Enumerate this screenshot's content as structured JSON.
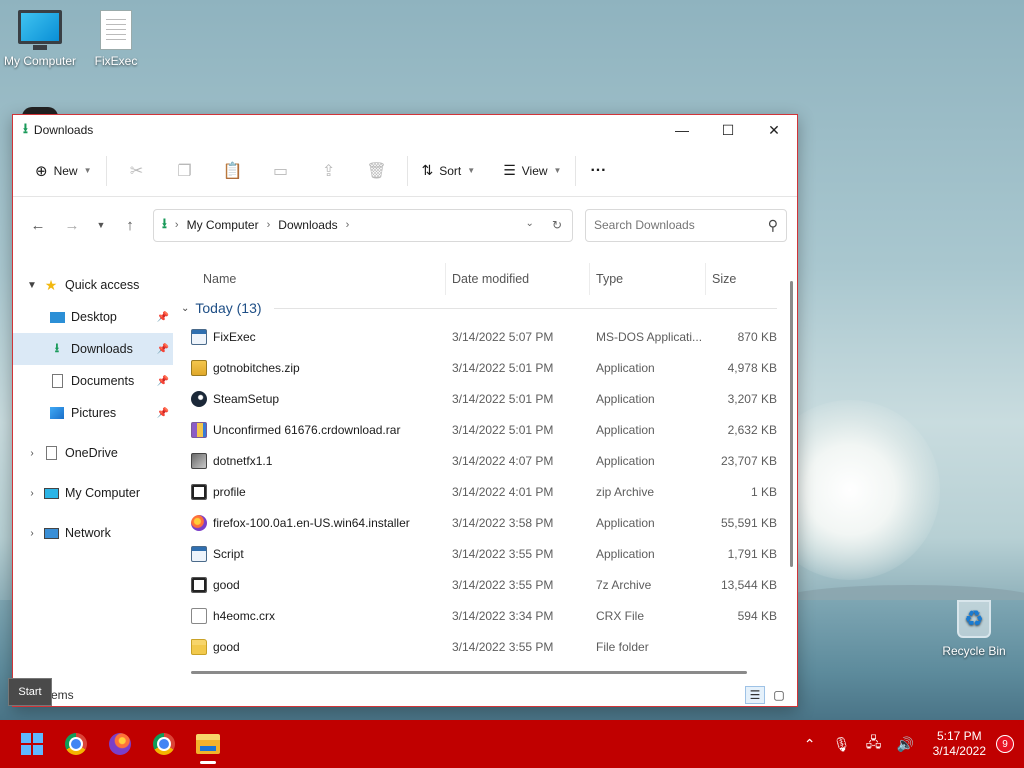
{
  "desktop": {
    "icons": [
      {
        "label": "My Computer"
      },
      {
        "label": "FixExec"
      },
      {
        "label": "Recycle Bin"
      }
    ]
  },
  "window": {
    "title": "Downloads",
    "controls": {
      "minimize": "—",
      "maximize": "☐",
      "close": "✕"
    },
    "toolbar": {
      "new_label": "New",
      "sort_label": "Sort",
      "view_label": "View",
      "more_label": "···"
    },
    "address": {
      "crumb1": "My Computer",
      "crumb2": "Downloads"
    },
    "search": {
      "placeholder": "Search Downloads"
    },
    "sidebar": {
      "quick_access": "Quick access",
      "items": [
        "Desktop",
        "Downloads",
        "Documents",
        "Pictures"
      ],
      "onedrive": "OneDrive",
      "my_computer": "My Computer",
      "network": "Network"
    },
    "columns": {
      "name": "Name",
      "date": "Date modified",
      "type": "Type",
      "size": "Size"
    },
    "group": "Today (13)",
    "files": [
      {
        "name": "FixExec",
        "date": "3/14/2022 5:07 PM",
        "type": "MS-DOS Applicati...",
        "size": "870 KB",
        "icon": "fi-app"
      },
      {
        "name": "gotnobitches.zip",
        "date": "3/14/2022 5:01 PM",
        "type": "Application",
        "size": "4,978 KB",
        "icon": "fi-zip"
      },
      {
        "name": "SteamSetup",
        "date": "3/14/2022 5:01 PM",
        "type": "Application",
        "size": "3,207 KB",
        "icon": "fi-steam"
      },
      {
        "name": "Unconfirmed 61676.crdownload.rar",
        "date": "3/14/2022 5:01 PM",
        "type": "Application",
        "size": "2,632 KB",
        "icon": "fi-rar"
      },
      {
        "name": "dotnetfx1.1",
        "date": "3/14/2022 4:07 PM",
        "type": "Application",
        "size": "23,707 KB",
        "icon": "fi-net"
      },
      {
        "name": "profile",
        "date": "3/14/2022 4:01 PM",
        "type": "zip Archive",
        "size": "1 KB",
        "icon": "fi-7z"
      },
      {
        "name": "firefox-100.0a1.en-US.win64.installer",
        "date": "3/14/2022 3:58 PM",
        "type": "Application",
        "size": "55,591 KB",
        "icon": "fi-ff"
      },
      {
        "name": "Script",
        "date": "3/14/2022 3:55 PM",
        "type": "Application",
        "size": "1,791 KB",
        "icon": "fi-app"
      },
      {
        "name": "good",
        "date": "3/14/2022 3:55 PM",
        "type": "7z Archive",
        "size": "13,544 KB",
        "icon": "fi-7z"
      },
      {
        "name": "h4eomc.crx",
        "date": "3/14/2022 3:34 PM",
        "type": "CRX File",
        "size": "594 KB",
        "icon": "fi-blank"
      },
      {
        "name": "good",
        "date": "3/14/2022 3:55 PM",
        "type": "File folder",
        "size": "",
        "icon": "fi-folder"
      }
    ],
    "status": "items"
  },
  "tooltip": "Start",
  "taskbar": {
    "time": "5:17 PM",
    "date": "3/14/2022",
    "notifications": "9"
  }
}
